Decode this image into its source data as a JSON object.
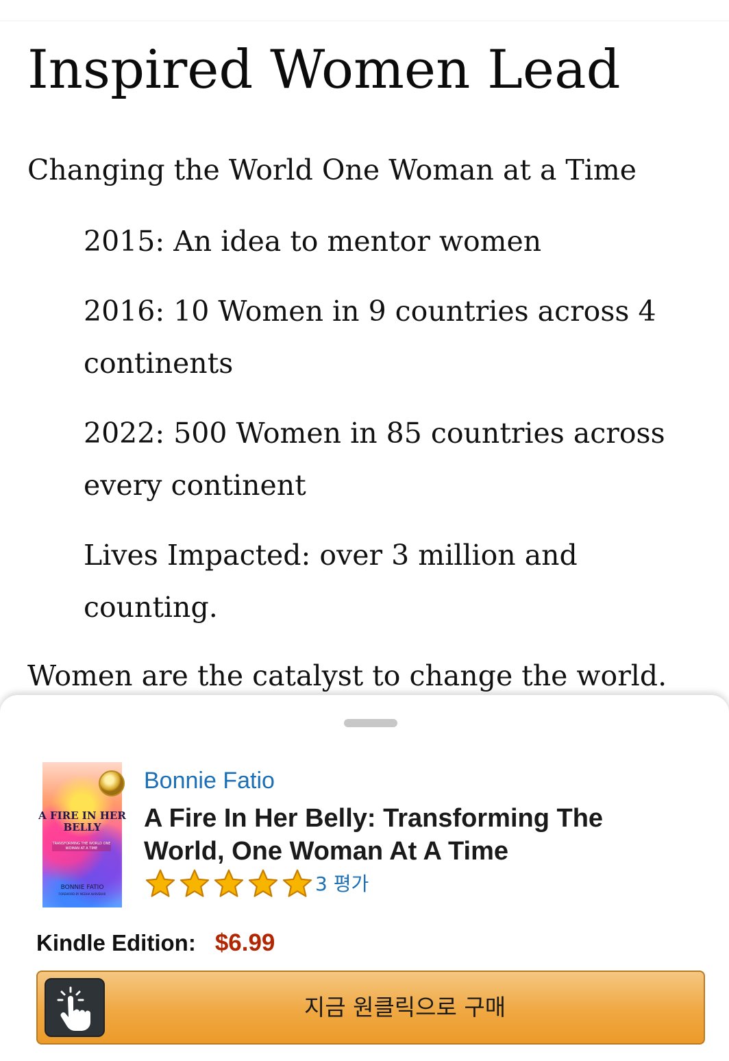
{
  "article": {
    "title": "Inspired Women Lead",
    "tagline": "Changing the World One Woman at a Time",
    "milestones": [
      "2015: An idea to mentor women",
      "2016: 10 Women in 9 countries across 4 continents",
      "2022: 500 Women in 85 countries across every continent",
      "Lives Impacted: over 3 million and counting."
    ],
    "closing": "Women are the catalyst to change the world."
  },
  "product": {
    "author": "Bonnie Fatio",
    "title": "A Fire In Her Belly: Transforming The World, One Woman At A Time",
    "rating": 5,
    "rating_max": 5,
    "rating_count_label": "3 평가",
    "edition_label": "Kindle Edition:",
    "price": "$6.99",
    "buy_button_label": "지금 원클릭으로 구매",
    "cover": {
      "title": "A FIRE IN HER BELLY",
      "subtitle": "TRANSFORMING THE WORLD ONE WOMAN AT A TIME",
      "author": "BONNIE FATIO",
      "foreword": "FOREWORD BY MEDHA NARVEKAR"
    }
  },
  "colors": {
    "link": "#1a6fb5",
    "price": "#b12704",
    "star_fill": "#f7b500",
    "star_stroke": "#c77c02",
    "button": "#f0a842"
  },
  "icons": {
    "star": "star-icon",
    "buy": "tap-finger-icon"
  }
}
